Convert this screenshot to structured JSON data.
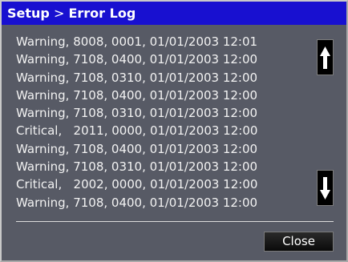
{
  "window": {
    "title_section": "Setup",
    "title_separator": ">",
    "title_page": "Error Log"
  },
  "log": {
    "entries": [
      "Warning, 8008, 0001, 01/01/2003 12:01",
      "Warning, 7108, 0400, 01/01/2003 12:00",
      "Warning, 7108, 0310, 01/01/2003 12:00",
      "Warning, 7108, 0400, 01/01/2003 12:00",
      "Warning, 7108, 0310, 01/01/2003 12:00",
      "Critical,   2011, 0000, 01/01/2003 12:00",
      "Warning, 7108, 0400, 01/01/2003 12:00",
      "Warning, 7108, 0310, 01/01/2003 12:00",
      "Critical,   2002, 0000, 01/01/2003 12:00",
      "Warning, 7108, 0400, 01/01/2003 12:00"
    ]
  },
  "controls": {
    "close_label": "Close",
    "scroll_up_icon": "arrow-up-icon",
    "scroll_down_icon": "arrow-down-icon"
  },
  "colors": {
    "titlebar": "#1810d0",
    "panel": "#575a65",
    "text": "#f2f2f2"
  }
}
